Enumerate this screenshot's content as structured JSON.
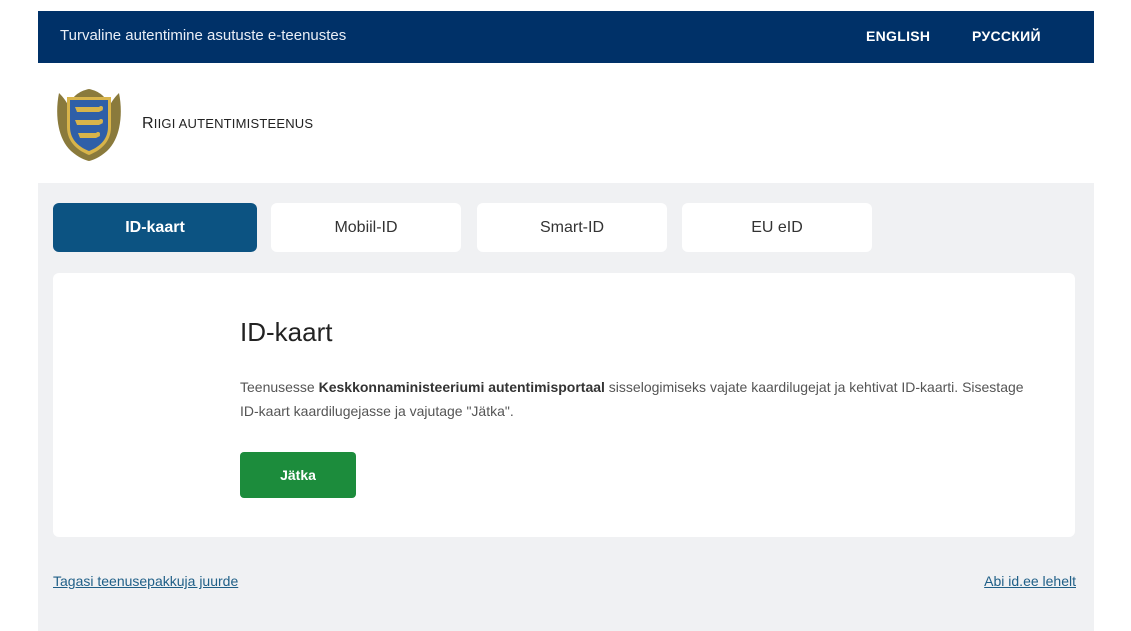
{
  "topbar": {
    "tagline": "Turvaline autentimine asutuste e-teenustes",
    "languages": [
      "ENGLISH",
      "РУССКИЙ"
    ]
  },
  "header": {
    "service_name_first": "R",
    "service_name_rest": "IIGI AUTENTIMISTEENUS",
    "logo_icon": "estonian-coat-of-arms-icon"
  },
  "tabs": [
    {
      "label": "ID-kaart",
      "active": true
    },
    {
      "label": "Mobiil-ID",
      "active": false
    },
    {
      "label": "Smart-ID",
      "active": false
    },
    {
      "label": "EU eID",
      "active": false
    }
  ],
  "card": {
    "title": "ID-kaart",
    "desc_before": "Teenusesse ",
    "desc_bold": "Keskkonnaministeeriumi autentimisportaal",
    "desc_after": " sisselogimiseks vajate kaardilugejat ja kehtivat ID-kaarti. Sisestage ID-kaart kaardilugejasse ja vajutage \"Jätka\".",
    "button_label": "Jätka"
  },
  "footer": {
    "back_link": "Tagasi teenusepakkuja juurde",
    "help_link": "Abi id.ee lehelt"
  },
  "colors": {
    "topbar_bg": "#003168",
    "tab_active_bg": "#0c5382",
    "button_bg": "#1c8c3c",
    "main_bg": "#f0f1f3",
    "link": "#1f5f87"
  }
}
